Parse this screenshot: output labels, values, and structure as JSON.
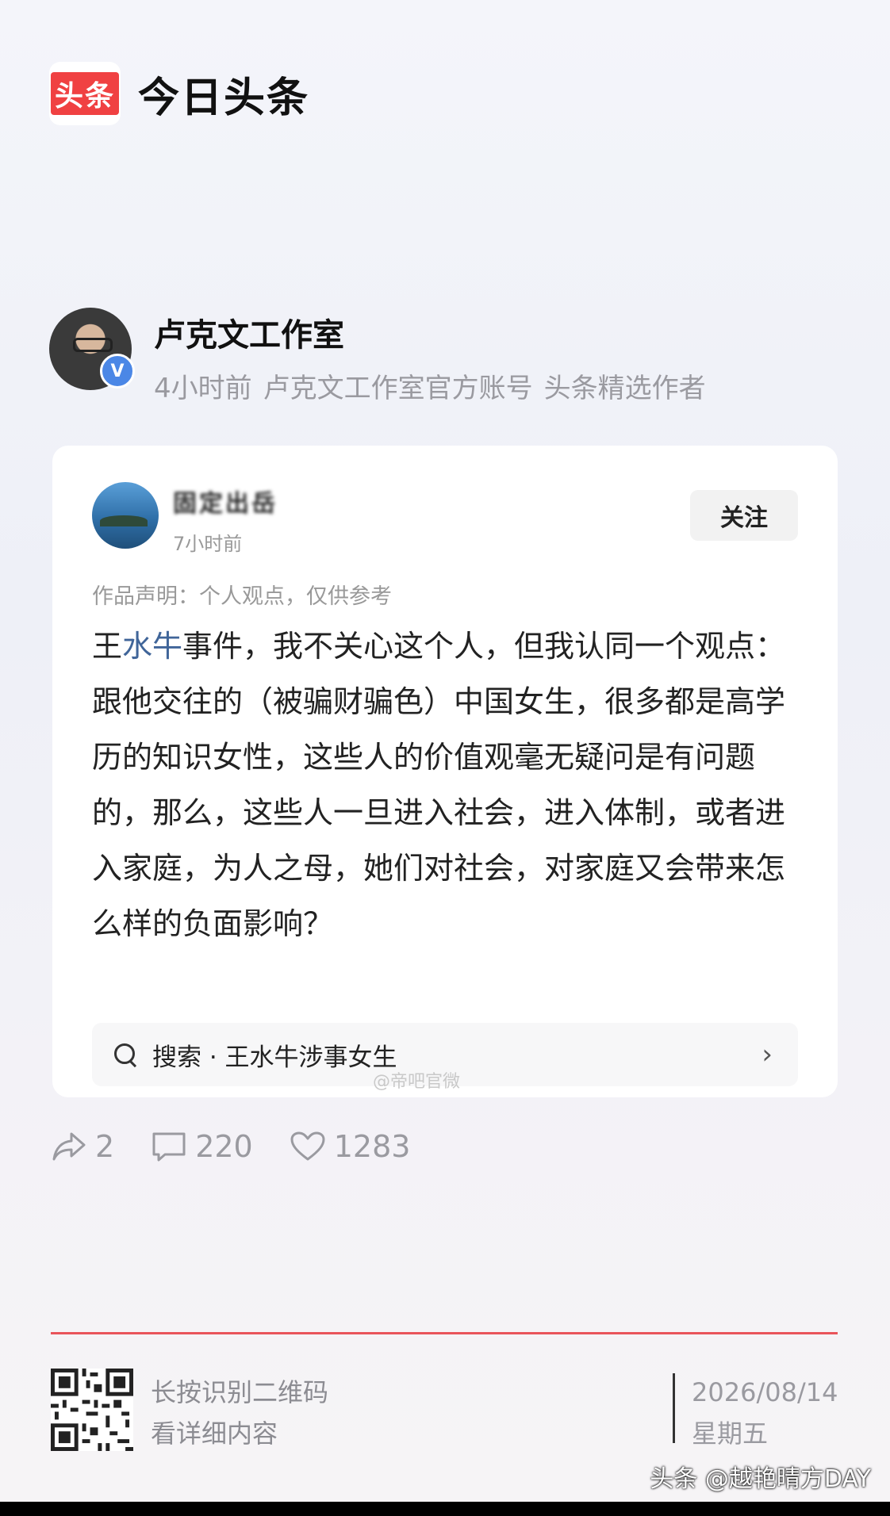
{
  "brand": {
    "logo_text": "头条",
    "name": "今日头条"
  },
  "author": {
    "name": "卢克文工作室",
    "verified_badge": "V",
    "meta": [
      "4小时前",
      "卢克文工作室官方账号",
      "头条精选作者"
    ]
  },
  "card": {
    "user_name": "固定出岳",
    "time": "7小时前",
    "follow_label": "关注",
    "declaration": "作品声明：个人观点，仅供参考",
    "body_highlight": "水牛",
    "body_prefix": "王",
    "body_rest": "事件，我不关心这个人，但我认同一个观点：跟他交往的（被骗财骗色）中国女生，很多都是高学历的知识女性，这些人的价值观毫无疑问是有问题的，那么，这些人一旦进入社会，进入体制，或者进入家庭，为人之母，她们对社会，对家庭又会带来怎么样的负面影响？",
    "search_label": "搜索 · 王水牛涉事女生",
    "search_chevron": "›",
    "watermark": "@帝吧官微"
  },
  "actions": {
    "shares": "2",
    "comments": "220",
    "likes": "1283"
  },
  "footer": {
    "qr_line1": "长按识别二维码",
    "qr_line2": "看详细内容",
    "date": "2026/08/14",
    "weekday": "星期五",
    "watermark": "头条 @越艳晴方DAY"
  },
  "colors": {
    "brand_red": "#f04142",
    "link_blue": "#406599",
    "divider_red": "#e9545a"
  }
}
